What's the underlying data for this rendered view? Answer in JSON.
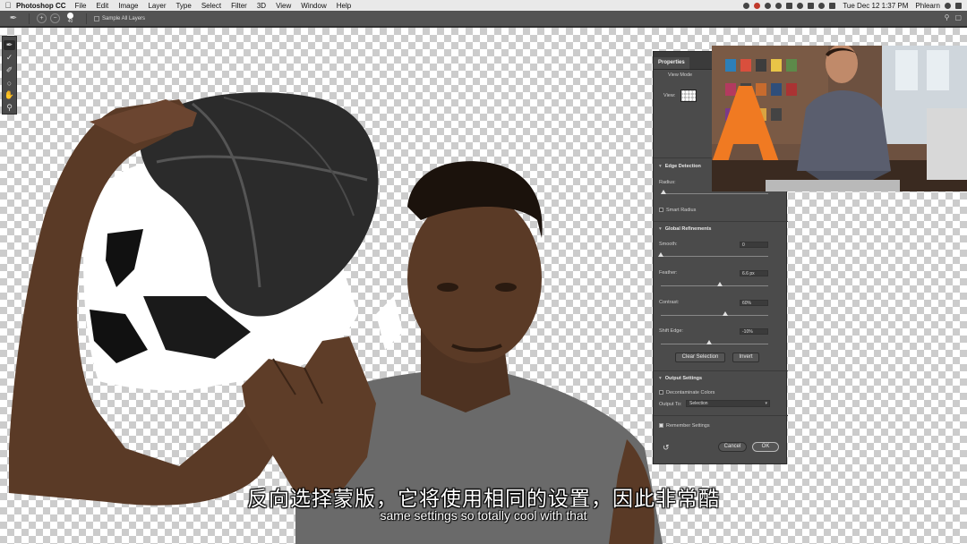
{
  "menubar": {
    "app_name": "Photoshop CC",
    "items": [
      "File",
      "Edit",
      "Image",
      "Layer",
      "Type",
      "Select",
      "Filter",
      "3D",
      "View",
      "Window",
      "Help"
    ],
    "clock": "Tue Dec 12  1:37 PM",
    "user": "Phlearn"
  },
  "options_bar": {
    "brush_size": "40",
    "sample_all_layers": "Sample All Layers"
  },
  "properties": {
    "title": "Properties",
    "view_mode": {
      "header": "View Mode",
      "view_label": "View:"
    },
    "edge_detection": {
      "header": "Edge Detection",
      "radius_label": "Radius:",
      "smart_radius": "Smart Radius"
    },
    "global_refinements": {
      "header": "Global Refinements",
      "smooth_label": "Smooth:",
      "smooth_value": "0",
      "smooth_level": 0,
      "feather_label": "Feather:",
      "feather_value": "6.6 px",
      "feather_level": 0.55,
      "contrast_label": "Contrast:",
      "contrast_value": "60%",
      "contrast_level": 0.6,
      "shift_edge_label": "Shift Edge:",
      "shift_edge_value": "-10%",
      "shift_edge_level": 0.45,
      "clear_selection": "Clear Selection",
      "invert": "Invert"
    },
    "output_settings": {
      "header": "Output Settings",
      "decontaminate": "Decontaminate Colors",
      "output_to_label": "Output To:",
      "output_to_value": "Selection"
    },
    "remember_settings": "Remember Settings",
    "cancel": "Cancel",
    "ok": "OK"
  },
  "subtitles": {
    "chinese": "反向选择蒙版，它将使用相同的设置，因此非常酷",
    "english": "same settings so totally cool with that"
  },
  "colors": {
    "panel_bg": "#4b4b4b",
    "ui_dark": "#535353",
    "skin": "#5a3a26",
    "shirt": "#6a6a6a",
    "ball": "#2b2b2b"
  }
}
